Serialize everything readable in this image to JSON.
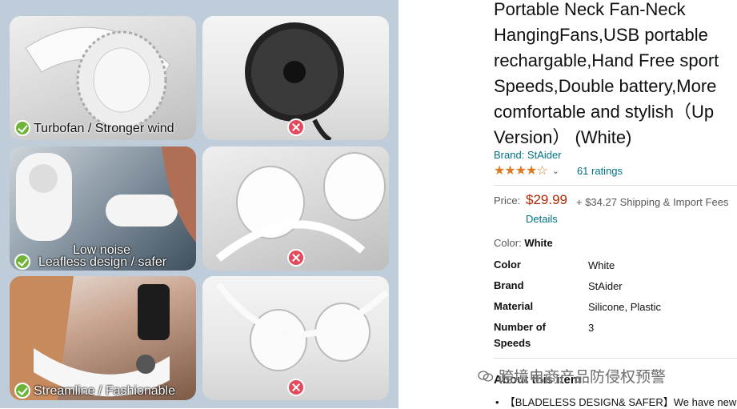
{
  "product": {
    "title_lines": [
      "Portable Neck Fan-Neck",
      "HangingFans,USB portable",
      "rechargable,Hand Free sport",
      "Speeds,Double battery,More",
      "comfortable and stylish（Up",
      "Version） (White)"
    ],
    "brand_link": "Brand: StAider",
    "rating_stars": "★★★★☆",
    "ratings_count": "61 ratings",
    "price_label": "Price:",
    "price": "$29.99",
    "shipping": "+ $34.27 Shipping & Import Fees",
    "details_link": "Details",
    "color_label": "Color:",
    "color_value": "White",
    "specs": [
      {
        "key": "Color",
        "value": "White"
      },
      {
        "key": "Brand",
        "value": "StAider"
      },
      {
        "key": "Material",
        "value": "Silicone, Plastic"
      },
      {
        "key": "Number of Speeds",
        "value": "3"
      }
    ],
    "about_heading": "About this item",
    "bullet_1": "【BLADELESS DESIGN& SAFER】We have new"
  },
  "comparison_image": {
    "good_captions": [
      "Turbofan  / Stronger wind",
      "Low noise",
      "Leafless design  / safer",
      "Streamline / Fashionable"
    ],
    "good_color": "#6fb43a",
    "bad_color": "#e34a5e"
  },
  "watermark": "跨境电商产品防侵权预警"
}
